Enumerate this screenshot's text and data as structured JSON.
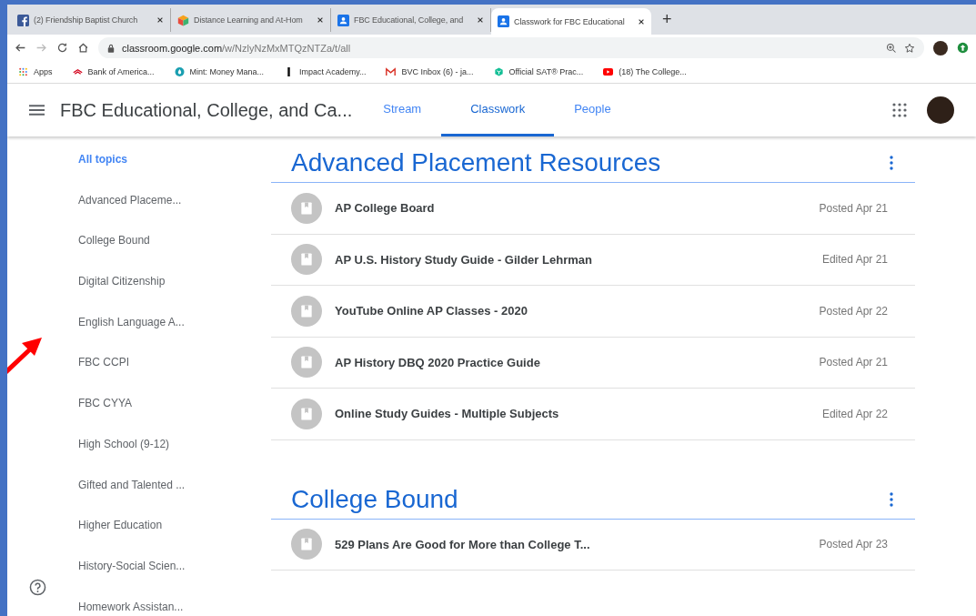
{
  "browser": {
    "tabs": [
      {
        "title": "(2) Friendship Baptist Church",
        "selected": false
      },
      {
        "title": "Distance Learning and At-Hom",
        "selected": false
      },
      {
        "title": "FBC Educational, College, and",
        "selected": false
      },
      {
        "title": "Classwork for FBC Educational",
        "selected": true
      }
    ],
    "new_tab": "+",
    "address": {
      "host": "classroom.google.com",
      "path": "/w/NzlyNzMxMTQzNTZa/t/all"
    },
    "bookmarks": [
      {
        "label": "Apps"
      },
      {
        "label": "Bank of America..."
      },
      {
        "label": "Mint: Money Mana..."
      },
      {
        "label": "Impact Academy..."
      },
      {
        "label": "BVC Inbox (6) - ja..."
      },
      {
        "label": "Official SAT® Prac..."
      },
      {
        "label": "(18) The College..."
      }
    ]
  },
  "app": {
    "course_title": "FBC Educational, College, and Ca...",
    "nav": [
      {
        "label": "Stream",
        "selected": false
      },
      {
        "label": "Classwork",
        "selected": true
      },
      {
        "label": "People",
        "selected": false
      }
    ]
  },
  "sidebar": {
    "topics": [
      {
        "label": "All topics",
        "selected": true
      },
      {
        "label": "Advanced Placeme...",
        "selected": false
      },
      {
        "label": "College Bound",
        "selected": false
      },
      {
        "label": "Digital Citizenship",
        "selected": false
      },
      {
        "label": "English Language A...",
        "selected": false
      },
      {
        "label": "FBC CCPI",
        "selected": false
      },
      {
        "label": "FBC CYYA",
        "selected": false
      },
      {
        "label": "High School (9-12)",
        "selected": false
      },
      {
        "label": "Gifted and Talented ...",
        "selected": false
      },
      {
        "label": "Higher Education",
        "selected": false
      },
      {
        "label": "History-Social Scien...",
        "selected": false
      },
      {
        "label": "Homework Assistan...",
        "selected": false
      }
    ]
  },
  "sections": [
    {
      "title": "Advanced Placement Resources",
      "items": [
        {
          "title": "AP College Board",
          "status": "Posted Apr 21"
        },
        {
          "title": "AP U.S. History Study Guide - Gilder Lehrman",
          "status": "Edited Apr 21"
        },
        {
          "title": "YouTube Online AP Classes - 2020",
          "status": "Posted Apr 22"
        },
        {
          "title": "AP History DBQ 2020 Practice Guide",
          "status": "Posted Apr 21"
        },
        {
          "title": "Online Study Guides - Multiple Subjects",
          "status": "Edited Apr 22"
        }
      ]
    },
    {
      "title": "College Bound",
      "items": [
        {
          "title": "529 Plans Are Good for More than College T...",
          "status": "Posted Apr 23"
        }
      ]
    }
  ]
}
